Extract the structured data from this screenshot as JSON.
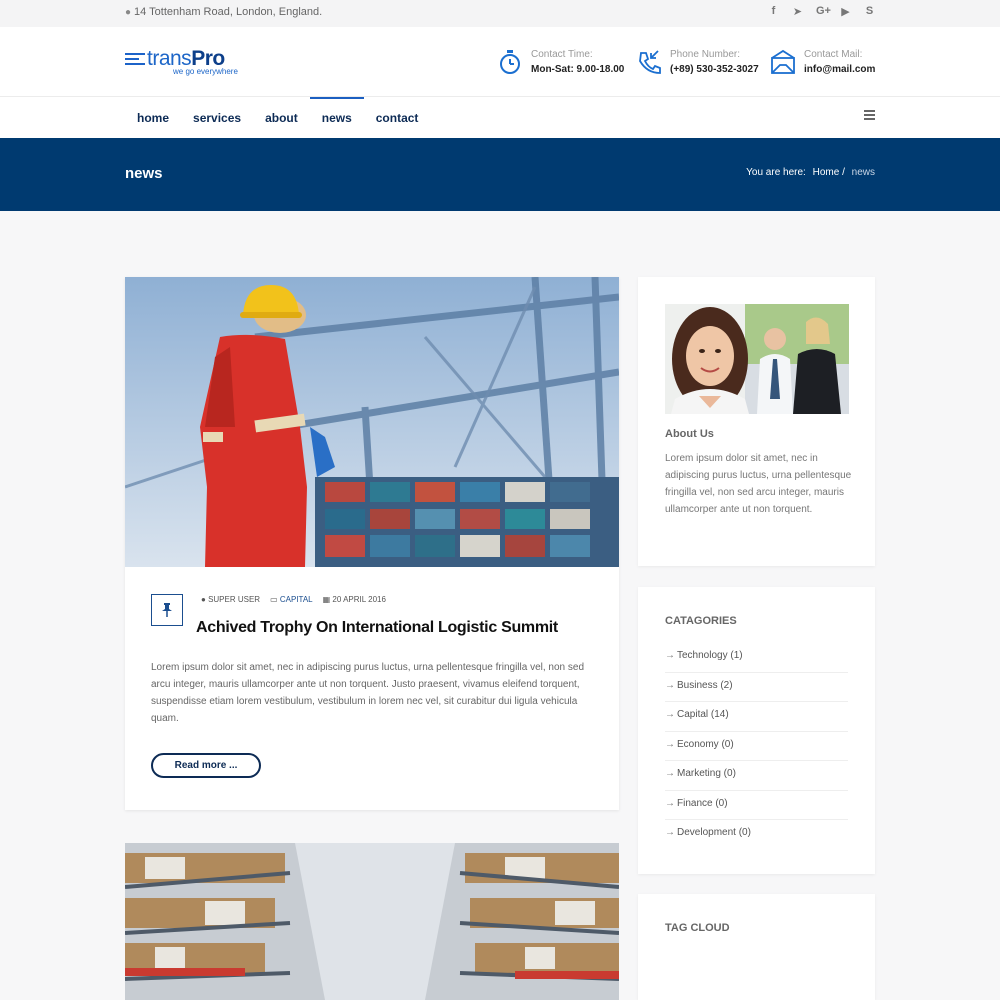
{
  "topbar": {
    "address": "14 Tottenham Road, London, England.",
    "socials": [
      "facebook-icon",
      "twitter-icon",
      "google-plus-icon",
      "youtube-icon",
      "skype-icon"
    ]
  },
  "header": {
    "logo": {
      "brand_light": "trans",
      "brand_bold": "Pro",
      "tagline": "we go everywhere"
    },
    "contacts": [
      {
        "icon": "stopwatch-icon",
        "label": "Contact Time:",
        "value": "Mon-Sat: 9.00-18.00"
      },
      {
        "icon": "phone-icon",
        "label": "Phone Number:",
        "value": "(+89) 530-352-3027"
      },
      {
        "icon": "mail-icon",
        "label": "Contact Mail:",
        "value": "info@mail.com"
      }
    ]
  },
  "nav": {
    "items": [
      "home",
      "services",
      "about",
      "news",
      "contact"
    ],
    "active": "news"
  },
  "banner": {
    "title": "news",
    "breadcrumb_prefix": "You are here:",
    "breadcrumb_home": "Home /",
    "breadcrumb_current": "news"
  },
  "post": {
    "author": "SUPER USER",
    "category": "CAPITAL",
    "date": "20 APRIL 2016",
    "title": "Achived Trophy On International Logistic Summit",
    "excerpt": "Lorem ipsum dolor sit amet, nec in adipiscing purus luctus, urna pellentesque fringilla vel, non sed arcu integer, mauris ullamcorper ante ut non torquent. Justo praesent, vivamus eleifend torquent, suspendisse etiam lorem vestibulum, vestibulum in lorem nec vel, sit curabitur dui ligula vehicula quam.",
    "read_more": "Read more ..."
  },
  "sidebar": {
    "about": {
      "heading": "About Us",
      "text": "Lorem ipsum dolor sit amet, nec in adipiscing purus luctus, urna pellentesque fringilla vel, non sed arcu integer, mauris ullamcorper ante ut non torquent."
    },
    "categories": {
      "heading": "CATAGORIES",
      "items": [
        "Technology (1)",
        "Business (2)",
        "Capital (14)",
        "Economy (0)",
        "Marketing (0)",
        "Finance (0)",
        "Development (0)"
      ]
    },
    "tag_cloud": {
      "heading": "TAG CLOUD"
    }
  },
  "colors": {
    "primary": "#003a70",
    "accent": "#1b5fc1",
    "nav_text": "#0d2b55"
  }
}
